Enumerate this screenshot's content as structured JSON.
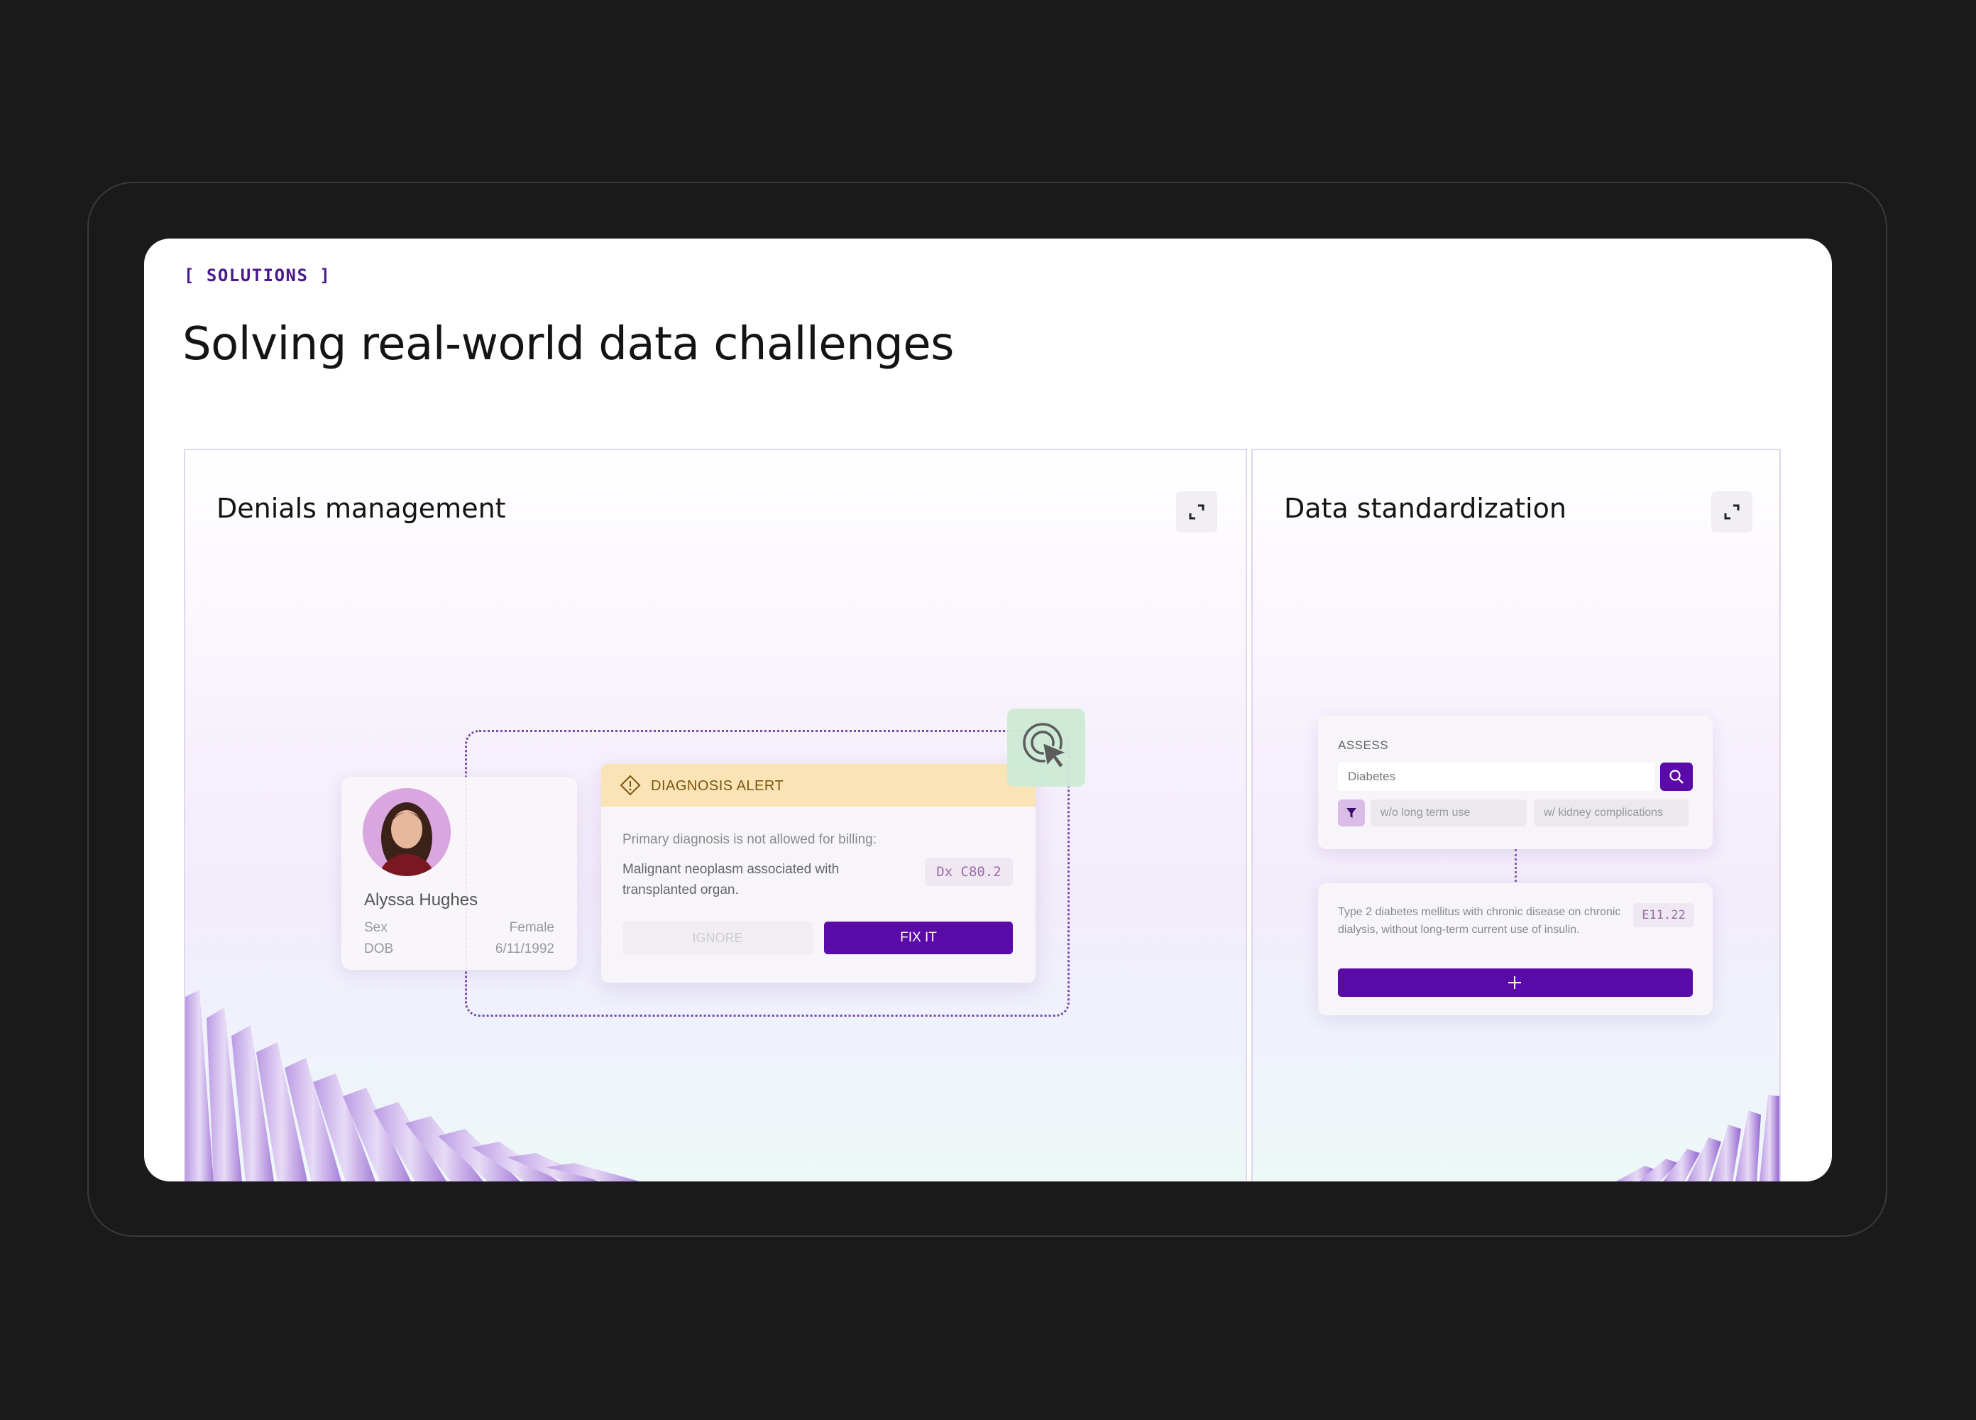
{
  "section": {
    "eyebrow": "[ SOLUTIONS ]",
    "title": "Solving real-world data challenges"
  },
  "panels": {
    "denials": {
      "title": "Denials management",
      "expand_icon": "expand-icon",
      "patient": {
        "name": "Alyssa Hughes",
        "sex_label": "Sex",
        "sex_value": "Female",
        "dob_label": "DOB",
        "dob_value": "6/11/1992"
      },
      "alert": {
        "icon": "warning-diamond-icon",
        "title": "DIAGNOSIS ALERT",
        "message": "Primary diagnosis is not allowed for billing:",
        "detail": "Malignant neoplasm associated with transplanted organ.",
        "code": "Dx C80.2",
        "ignore_label": "IGNORE",
        "fix_label": "FIX IT"
      },
      "cursor_icon": "click-cursor-icon"
    },
    "standardization": {
      "title": "Data standardization",
      "expand_icon": "expand-icon",
      "assess": {
        "label": "ASSESS",
        "input_value": "Diabetes",
        "search_icon": "search-icon",
        "filter_icon": "filter-icon",
        "chips": [
          "w/o long term use",
          "w/ kidney complications"
        ]
      },
      "result": {
        "text": "Type 2 diabetes mellitus with chronic disease on chronic dialysis, without long-term current use of insulin.",
        "code": "E11.22",
        "add_icon": "plus-icon"
      }
    }
  },
  "colors": {
    "background": "#1a1a1a",
    "accent": "#5a0aa6",
    "alert_header": "#fae3b4",
    "cursor_highlight": "#cdebd7"
  }
}
